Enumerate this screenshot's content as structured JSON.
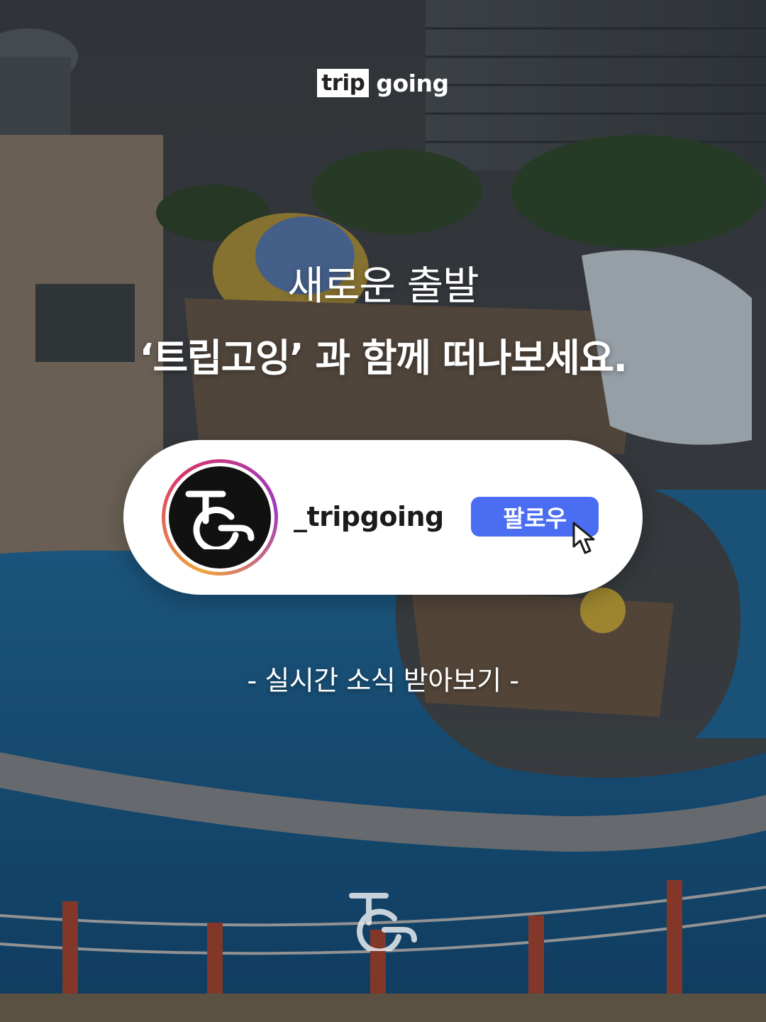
{
  "brand": {
    "trip_label": "trip",
    "going_label": "going"
  },
  "headline": {
    "line1": "새로운 출발",
    "line2": "‘트립고잉’ 과 함께 떠나보세요."
  },
  "profile_card": {
    "username": "_tripgoing",
    "follow_label": "팔로우",
    "avatar_icon": "tripgoing-logo-icon",
    "cursor_icon": "mouse-pointer-icon"
  },
  "subtext": "- 실시간 소식 받아보기 -",
  "colors": {
    "follow_button": "#4a6df2",
    "card_background": "#ffffff",
    "text_light": "#ffffff"
  }
}
